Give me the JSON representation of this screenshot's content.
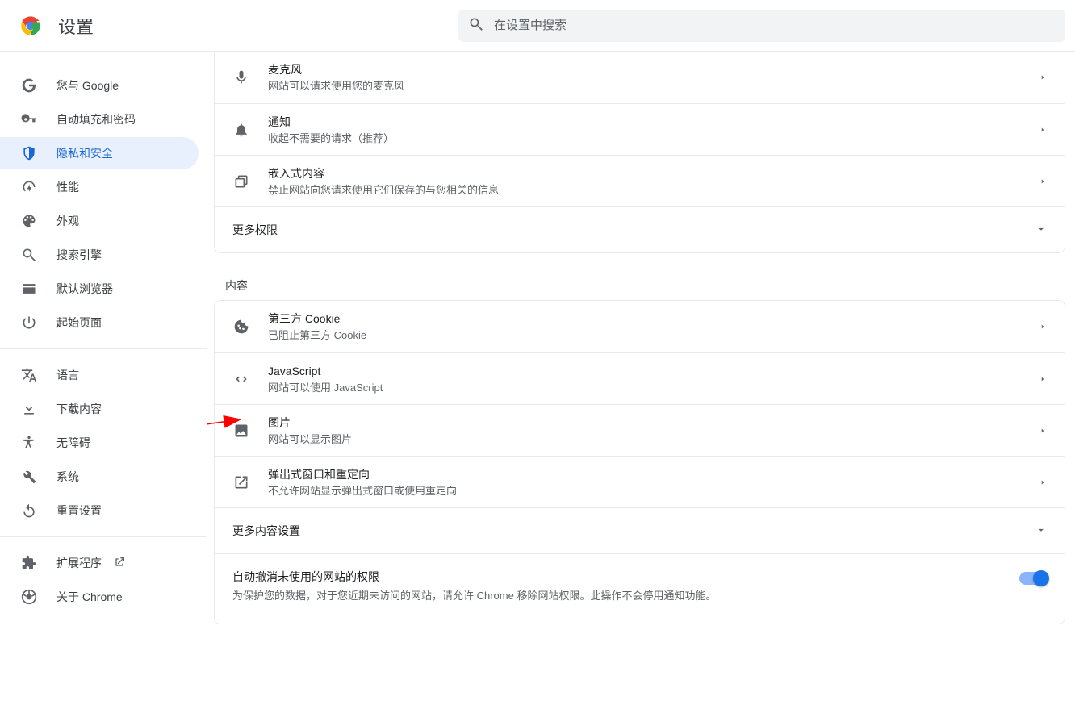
{
  "header": {
    "title": "设置",
    "search_placeholder": "在设置中搜索"
  },
  "sidebar": {
    "group1": [
      {
        "icon": "google",
        "label": "您与 Google"
      },
      {
        "icon": "key",
        "label": "自动填充和密码"
      },
      {
        "icon": "shield",
        "label": "隐私和安全",
        "selected": true
      },
      {
        "icon": "speed",
        "label": "性能"
      },
      {
        "icon": "palette",
        "label": "外观"
      },
      {
        "icon": "search",
        "label": "搜索引擎"
      },
      {
        "icon": "browser",
        "label": "默认浏览器"
      },
      {
        "icon": "power",
        "label": "起始页面"
      }
    ],
    "group2": [
      {
        "icon": "translate",
        "label": "语言"
      },
      {
        "icon": "download",
        "label": "下载内容"
      },
      {
        "icon": "accessibility",
        "label": "无障碍"
      },
      {
        "icon": "wrench",
        "label": "系统"
      },
      {
        "icon": "reset",
        "label": "重置设置"
      }
    ],
    "group3": [
      {
        "icon": "extension",
        "label": "扩展程序",
        "external": true
      },
      {
        "icon": "chrome",
        "label": "关于 Chrome"
      }
    ]
  },
  "content": {
    "permissions": [
      {
        "icon": "mic",
        "title": "麦克风",
        "sub": "网站可以请求使用您的麦克风"
      },
      {
        "icon": "bell",
        "title": "通知",
        "sub": "收起不需要的请求（推荐）"
      },
      {
        "icon": "embed",
        "title": "嵌入式内容",
        "sub": "禁止网站向您请求使用它们保存的与您相关的信息"
      }
    ],
    "more_permissions": "更多权限",
    "content_label": "内容",
    "content_items": [
      {
        "icon": "cookie",
        "title": "第三方 Cookie",
        "sub": "已阻止第三方 Cookie"
      },
      {
        "icon": "code",
        "title": "JavaScript",
        "sub": "网站可以使用 JavaScript"
      },
      {
        "icon": "image",
        "title": "图片",
        "sub": "网站可以显示图片"
      },
      {
        "icon": "popup",
        "title": "弹出式窗口和重定向",
        "sub": "不允许网站显示弹出式窗口或使用重定向"
      }
    ],
    "more_content": "更多内容设置",
    "auto_revoke": {
      "title": "自动撤消未使用的网站的权限",
      "sub": "为保护您的数据，对于您近期未访问的网站，请允许 Chrome 移除网站权限。此操作不会停用通知功能。"
    }
  }
}
